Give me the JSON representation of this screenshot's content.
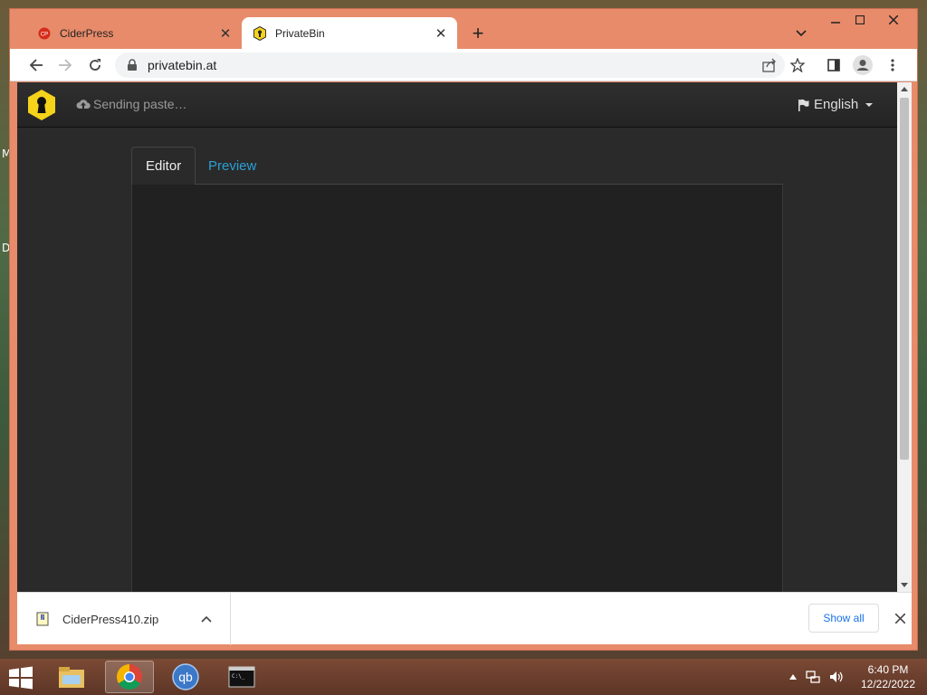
{
  "browser": {
    "tabs": [
      {
        "title": "CiderPress",
        "favicon": "ciderpress-icon",
        "active": false
      },
      {
        "title": "PrivateBin",
        "favicon": "privatebin-icon",
        "active": true
      }
    ],
    "address": "privatebin.at"
  },
  "page": {
    "status": "Sending paste…",
    "language": "English",
    "tabs": {
      "editor": "Editor",
      "preview": "Preview"
    },
    "colors": {
      "link": "#2a9fd6",
      "logo": "#f5d31b"
    }
  },
  "downloads": {
    "file": "CiderPress410.zip",
    "show_all": "Show all"
  },
  "taskbar": {
    "time": "6:40 PM",
    "date": "12/22/2022",
    "apps": [
      "file-explorer-icon",
      "chrome-icon",
      "qbittorrent-icon",
      "command-prompt-icon"
    ]
  },
  "desktop": {
    "letters": [
      "M",
      "D"
    ]
  }
}
